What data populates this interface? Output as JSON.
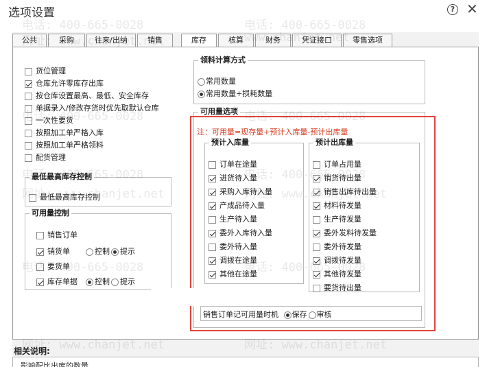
{
  "window": {
    "title": "选项设置"
  },
  "tabs": [
    "公共",
    "采购",
    "往来/出纳",
    "销售",
    "库存",
    "核算",
    "财务",
    "凭证接口",
    "零售选项"
  ],
  "left_options": [
    {
      "label": "货位管理",
      "checked": false
    },
    {
      "label": "仓库允许零库存出库",
      "checked": true
    },
    {
      "label": "按仓库设置最高、最低、安全库存",
      "checked": false
    },
    {
      "label": "单据录入/修改存货时优先取默认仓库",
      "checked": false
    },
    {
      "label": "一次性要货",
      "checked": false
    },
    {
      "label": "按照加工单严格入库",
      "checked": false
    },
    {
      "label": "按照加工单严格领料",
      "checked": false
    },
    {
      "label": "配货管理",
      "checked": false
    }
  ],
  "max_stock_group": {
    "title": "最低最高库存控制",
    "option": {
      "label": "最低最高库存控制",
      "checked": false
    }
  },
  "available_control": {
    "title": "可用量控制",
    "rows": [
      {
        "label": "销售订单",
        "checked": false
      },
      {
        "label": "销货单",
        "checked": true,
        "radio_a": "控制",
        "radio_b": "提示",
        "selected": "提示"
      },
      {
        "label": "要货单",
        "checked": false
      },
      {
        "label": "库存单据",
        "checked": true,
        "radio_a": "控制",
        "radio_b": "提示",
        "selected": "控制"
      }
    ]
  },
  "material_calc": {
    "title": "领料计算方式",
    "options": [
      "常用数量",
      "常用数量+损耗数量"
    ],
    "selected": "常用数量+损耗数量"
  },
  "available_options": {
    "title": "可用量选项",
    "note": "注：可用量=现存量+预计入库量-预计出库量",
    "inbound": {
      "title": "预计入库量",
      "items": [
        {
          "label": "订单在途量",
          "checked": false
        },
        {
          "label": "进货待入量",
          "checked": true
        },
        {
          "label": "采购入库待入量",
          "checked": true
        },
        {
          "label": "产成品待入量",
          "checked": true
        },
        {
          "label": "生产待入量",
          "checked": false
        },
        {
          "label": "委外入库待入量",
          "checked": true
        },
        {
          "label": "委外待入量",
          "checked": false
        },
        {
          "label": "调拨在途量",
          "checked": true
        },
        {
          "label": "其他在途量",
          "checked": true
        }
      ]
    },
    "outbound": {
      "title": "预计出库量",
      "items": [
        {
          "label": "订单占用量",
          "checked": false
        },
        {
          "label": "销货待出量",
          "checked": true
        },
        {
          "label": "销售出库待出量",
          "checked": true
        },
        {
          "label": "材料待发量",
          "checked": true
        },
        {
          "label": "生产待发量",
          "checked": false
        },
        {
          "label": "委外发料待发量",
          "checked": true
        },
        {
          "label": "委外待发量",
          "checked": false
        },
        {
          "label": "调拨待发量",
          "checked": true
        },
        {
          "label": "其他待发量",
          "checked": true
        },
        {
          "label": "要货待出量",
          "checked": false
        }
      ]
    },
    "record_timing": {
      "label": "销售订单记可用量时机",
      "options": [
        "保存",
        "审核"
      ],
      "selected": "保存"
    }
  },
  "description": {
    "title": "相关说明:",
    "text": "影响配比出库的数量"
  },
  "watermarks": {
    "phone": "电话: 400-665-0028",
    "site": "网址: www.chanjet.net",
    "site_short": "www.chanjet.net"
  }
}
